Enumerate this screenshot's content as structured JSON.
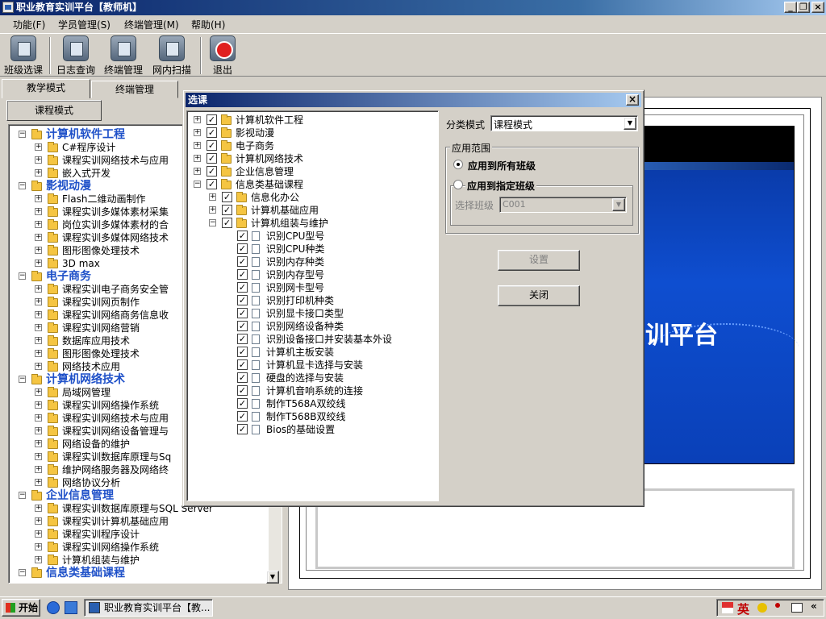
{
  "window": {
    "title": "职业教育实训平台【教师机】"
  },
  "menu": [
    "功能(F)",
    "学员管理(S)",
    "终端管理(M)",
    "帮助(H)"
  ],
  "toolbar": [
    "班级选课",
    "日志查询",
    "终端管理",
    "网内扫描",
    "退出"
  ],
  "tabs": [
    "教学模式",
    "终端管理"
  ],
  "left": {
    "mode_button": "课程模式",
    "tree": [
      {
        "t": "cat",
        "label": "计算机软件工程"
      },
      {
        "t": "item",
        "label": "C#程序设计"
      },
      {
        "t": "item",
        "label": "课程实训网络技术与应用"
      },
      {
        "t": "item",
        "label": "嵌入式开发"
      },
      {
        "t": "cat",
        "label": "影视动漫"
      },
      {
        "t": "item",
        "label": "Flash二维动画制作"
      },
      {
        "t": "item",
        "label": "课程实训多媒体素材采集"
      },
      {
        "t": "item",
        "label": "岗位实训多媒体素材的合"
      },
      {
        "t": "item",
        "label": "课程实训多媒体网络技术"
      },
      {
        "t": "item",
        "label": "图形图像处理技术"
      },
      {
        "t": "item",
        "label": "3D max"
      },
      {
        "t": "cat",
        "label": "电子商务"
      },
      {
        "t": "item",
        "label": "课程实训电子商务安全管"
      },
      {
        "t": "item",
        "label": "课程实训网页制作"
      },
      {
        "t": "item",
        "label": "课程实训网络商务信息收"
      },
      {
        "t": "item",
        "label": "课程实训网络营销"
      },
      {
        "t": "item",
        "label": "数据库应用技术"
      },
      {
        "t": "item",
        "label": "图形图像处理技术"
      },
      {
        "t": "item",
        "label": "网络技术应用"
      },
      {
        "t": "cat",
        "label": "计算机网络技术"
      },
      {
        "t": "item",
        "label": "局域网管理"
      },
      {
        "t": "item",
        "label": "课程实训网络操作系统"
      },
      {
        "t": "item",
        "label": "课程实训网络技术与应用"
      },
      {
        "t": "item",
        "label": "课程实训网络设备管理与"
      },
      {
        "t": "item",
        "label": "网络设备的维护"
      },
      {
        "t": "item",
        "label": "课程实训数据库原理与Sq"
      },
      {
        "t": "item",
        "label": "维护网络服务器及网络终"
      },
      {
        "t": "item",
        "label": "网络协议分析"
      },
      {
        "t": "cat",
        "label": "企业信息管理"
      },
      {
        "t": "item",
        "label": "课程实训数据库原理与SQL Server"
      },
      {
        "t": "item",
        "label": "课程实训计算机基础应用"
      },
      {
        "t": "item",
        "label": "课程实训程序设计"
      },
      {
        "t": "item",
        "label": "课程实训网络操作系统"
      },
      {
        "t": "item",
        "label": "计算机组装与维护"
      },
      {
        "t": "cat",
        "label": "信息类基础课程"
      }
    ]
  },
  "preview": {
    "banner_text": "训平台"
  },
  "dialog": {
    "title": "选课",
    "close_glyph": "×",
    "tree": [
      {
        "lvl": 0,
        "exp": "+",
        "label": "计算机软件工程"
      },
      {
        "lvl": 0,
        "exp": "+",
        "label": "影视动漫"
      },
      {
        "lvl": 0,
        "exp": "+",
        "label": "电子商务"
      },
      {
        "lvl": 0,
        "exp": "+",
        "label": "计算机网络技术"
      },
      {
        "lvl": 0,
        "exp": "+",
        "label": "企业信息管理"
      },
      {
        "lvl": 0,
        "exp": "-",
        "label": "信息类基础课程"
      },
      {
        "lvl": 1,
        "exp": "+",
        "label": "信息化办公"
      },
      {
        "lvl": 1,
        "exp": "+",
        "label": "计算机基础应用"
      },
      {
        "lvl": 1,
        "exp": "-",
        "label": "计算机组装与维护"
      },
      {
        "lvl": 2,
        "label": "识别CPU型号"
      },
      {
        "lvl": 2,
        "label": "识别CPU种类"
      },
      {
        "lvl": 2,
        "label": "识别内存种类"
      },
      {
        "lvl": 2,
        "label": "识别内存型号"
      },
      {
        "lvl": 2,
        "label": "识别网卡型号"
      },
      {
        "lvl": 2,
        "label": "识别打印机种类"
      },
      {
        "lvl": 2,
        "label": "识别显卡接口类型"
      },
      {
        "lvl": 2,
        "label": "识别网络设备种类"
      },
      {
        "lvl": 2,
        "label": "识别设备接口并安装基本外设"
      },
      {
        "lvl": 2,
        "label": "计算机主板安装"
      },
      {
        "lvl": 2,
        "label": "计算机显卡选择与安装"
      },
      {
        "lvl": 2,
        "label": "硬盘的选择与安装"
      },
      {
        "lvl": 2,
        "label": "计算机音响系统的连接"
      },
      {
        "lvl": 2,
        "label": "制作T568A双绞线"
      },
      {
        "lvl": 2,
        "label": "制作T568B双绞线"
      },
      {
        "lvl": 2,
        "label": "Bios的基础设置"
      }
    ],
    "category_mode_label": "分类模式",
    "category_mode_value": "课程模式",
    "scope_group_label": "应用范围",
    "radio_all": "应用到所有班级",
    "radio_specific": "应用到指定班级",
    "select_class_label": "选择班级",
    "select_class_value": "C001",
    "set_button": "设置",
    "close_button": "关闭"
  },
  "taskbar": {
    "start": "开始",
    "task": "职业教育实训平台【教...",
    "ime": "英",
    "chevron": "«"
  },
  "glyphs": {
    "checked": "✓",
    "minimize": "_",
    "restore": "❐",
    "close": "×",
    "dropdown": "▼",
    "scroll_up": "▲",
    "scroll_down": "▼"
  }
}
